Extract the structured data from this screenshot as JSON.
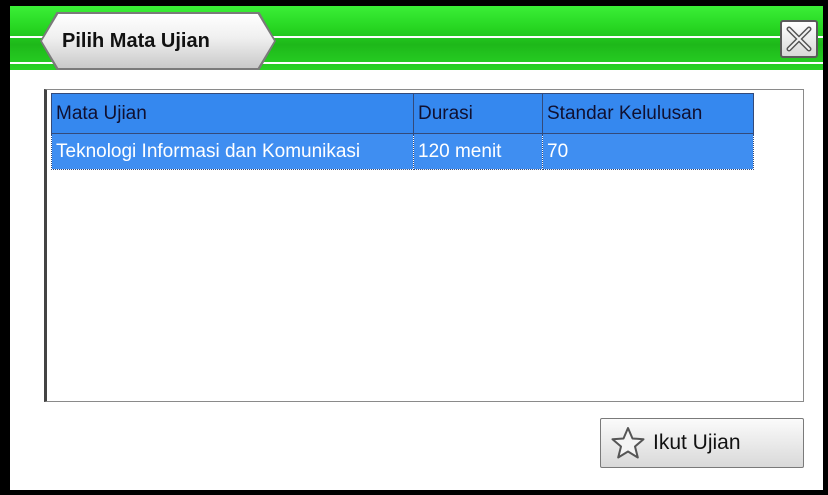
{
  "window": {
    "title": "Pilih Mata Ujian",
    "close_icon": "close-icon"
  },
  "table": {
    "columns": [
      "Mata Ujian",
      "Durasi",
      "Standar Kelulusan"
    ],
    "rows": [
      [
        "Teknologi Informasi dan Komunikasi",
        "120 menit",
        "70"
      ]
    ],
    "selected_row": 0,
    "header_color": "#3588ef",
    "selection_color": "#3f8ef1"
  },
  "actions": {
    "start_label": "Ikut Ujian",
    "start_icon": "star-icon"
  },
  "colors": {
    "titlebar": "#26d521",
    "accent": "#3588ef"
  }
}
